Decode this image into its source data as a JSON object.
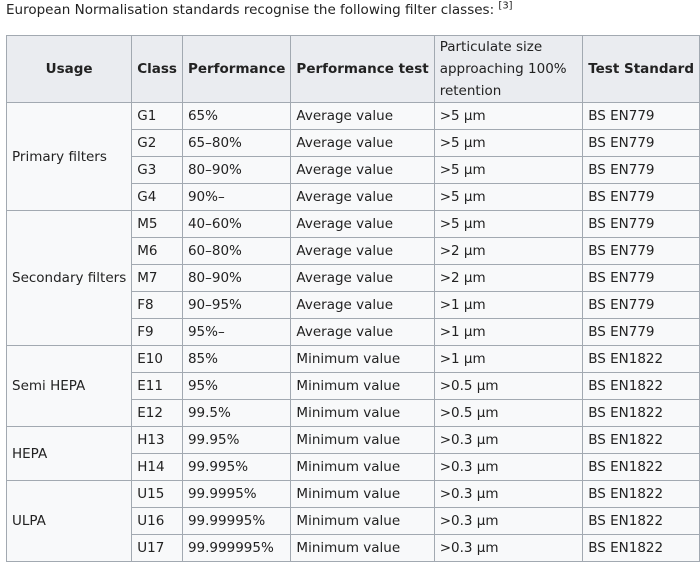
{
  "intro": {
    "text": "European Normalisation standards recognise the following filter classes:",
    "ref": "[3]"
  },
  "headers": {
    "usage": "Usage",
    "class": "Class",
    "performance": "Performance",
    "performance_test": "Performance test",
    "particulate_line1": "Particulate size",
    "particulate_line2": "approaching 100% retention",
    "test_standard": "Test Standard"
  },
  "groups": [
    {
      "usage": "Primary filters",
      "rows": [
        {
          "class": "G1",
          "performance": "65%",
          "test": "Average value",
          "size": ">5 µm",
          "standard": "BS EN779"
        },
        {
          "class": "G2",
          "performance": "65–80%",
          "test": "Average value",
          "size": ">5 µm",
          "standard": "BS EN779"
        },
        {
          "class": "G3",
          "performance": "80–90%",
          "test": "Average value",
          "size": ">5 µm",
          "standard": "BS EN779"
        },
        {
          "class": "G4",
          "performance": "90%–",
          "test": "Average value",
          "size": ">5 µm",
          "standard": "BS EN779"
        }
      ]
    },
    {
      "usage": "Secondary filters",
      "rows": [
        {
          "class": "M5",
          "performance": "40–60%",
          "test": "Average value",
          "size": ">5 µm",
          "standard": "BS EN779"
        },
        {
          "class": "M6",
          "performance": "60–80%",
          "test": "Average value",
          "size": ">2 µm",
          "standard": "BS EN779"
        },
        {
          "class": "M7",
          "performance": "80–90%",
          "test": "Average value",
          "size": ">2 µm",
          "standard": "BS EN779"
        },
        {
          "class": "F8",
          "performance": "90–95%",
          "test": "Average value",
          "size": ">1 µm",
          "standard": "BS EN779"
        },
        {
          "class": "F9",
          "performance": "95%–",
          "test": "Average value",
          "size": ">1 µm",
          "standard": "BS EN779"
        }
      ]
    },
    {
      "usage": "Semi HEPA",
      "rows": [
        {
          "class": "E10",
          "performance": "85%",
          "test": "Minimum value",
          "size": ">1 µm",
          "standard": "BS EN1822"
        },
        {
          "class": "E11",
          "performance": "95%",
          "test": "Minimum value",
          "size": ">0.5 µm",
          "standard": "BS EN1822"
        },
        {
          "class": "E12",
          "performance": "99.5%",
          "test": "Minimum value",
          "size": ">0.5 µm",
          "standard": "BS EN1822"
        }
      ]
    },
    {
      "usage": "HEPA",
      "rows": [
        {
          "class": "H13",
          "performance": "99.95%",
          "test": "Minimum value",
          "size": ">0.3 µm",
          "standard": "BS EN1822"
        },
        {
          "class": "H14",
          "performance": "99.995%",
          "test": "Minimum value",
          "size": ">0.3 µm",
          "standard": "BS EN1822"
        }
      ]
    },
    {
      "usage": "ULPA",
      "rows": [
        {
          "class": "U15",
          "performance": "99.9995%",
          "test": "Minimum value",
          "size": ">0.3 µm",
          "standard": "BS EN1822"
        },
        {
          "class": "U16",
          "performance": "99.99995%",
          "test": "Minimum value",
          "size": ">0.3 µm",
          "standard": "BS EN1822"
        },
        {
          "class": "U17",
          "performance": "99.999995%",
          "test": "Minimum value",
          "size": ">0.3 µm",
          "standard": "BS EN1822"
        }
      ]
    }
  ]
}
